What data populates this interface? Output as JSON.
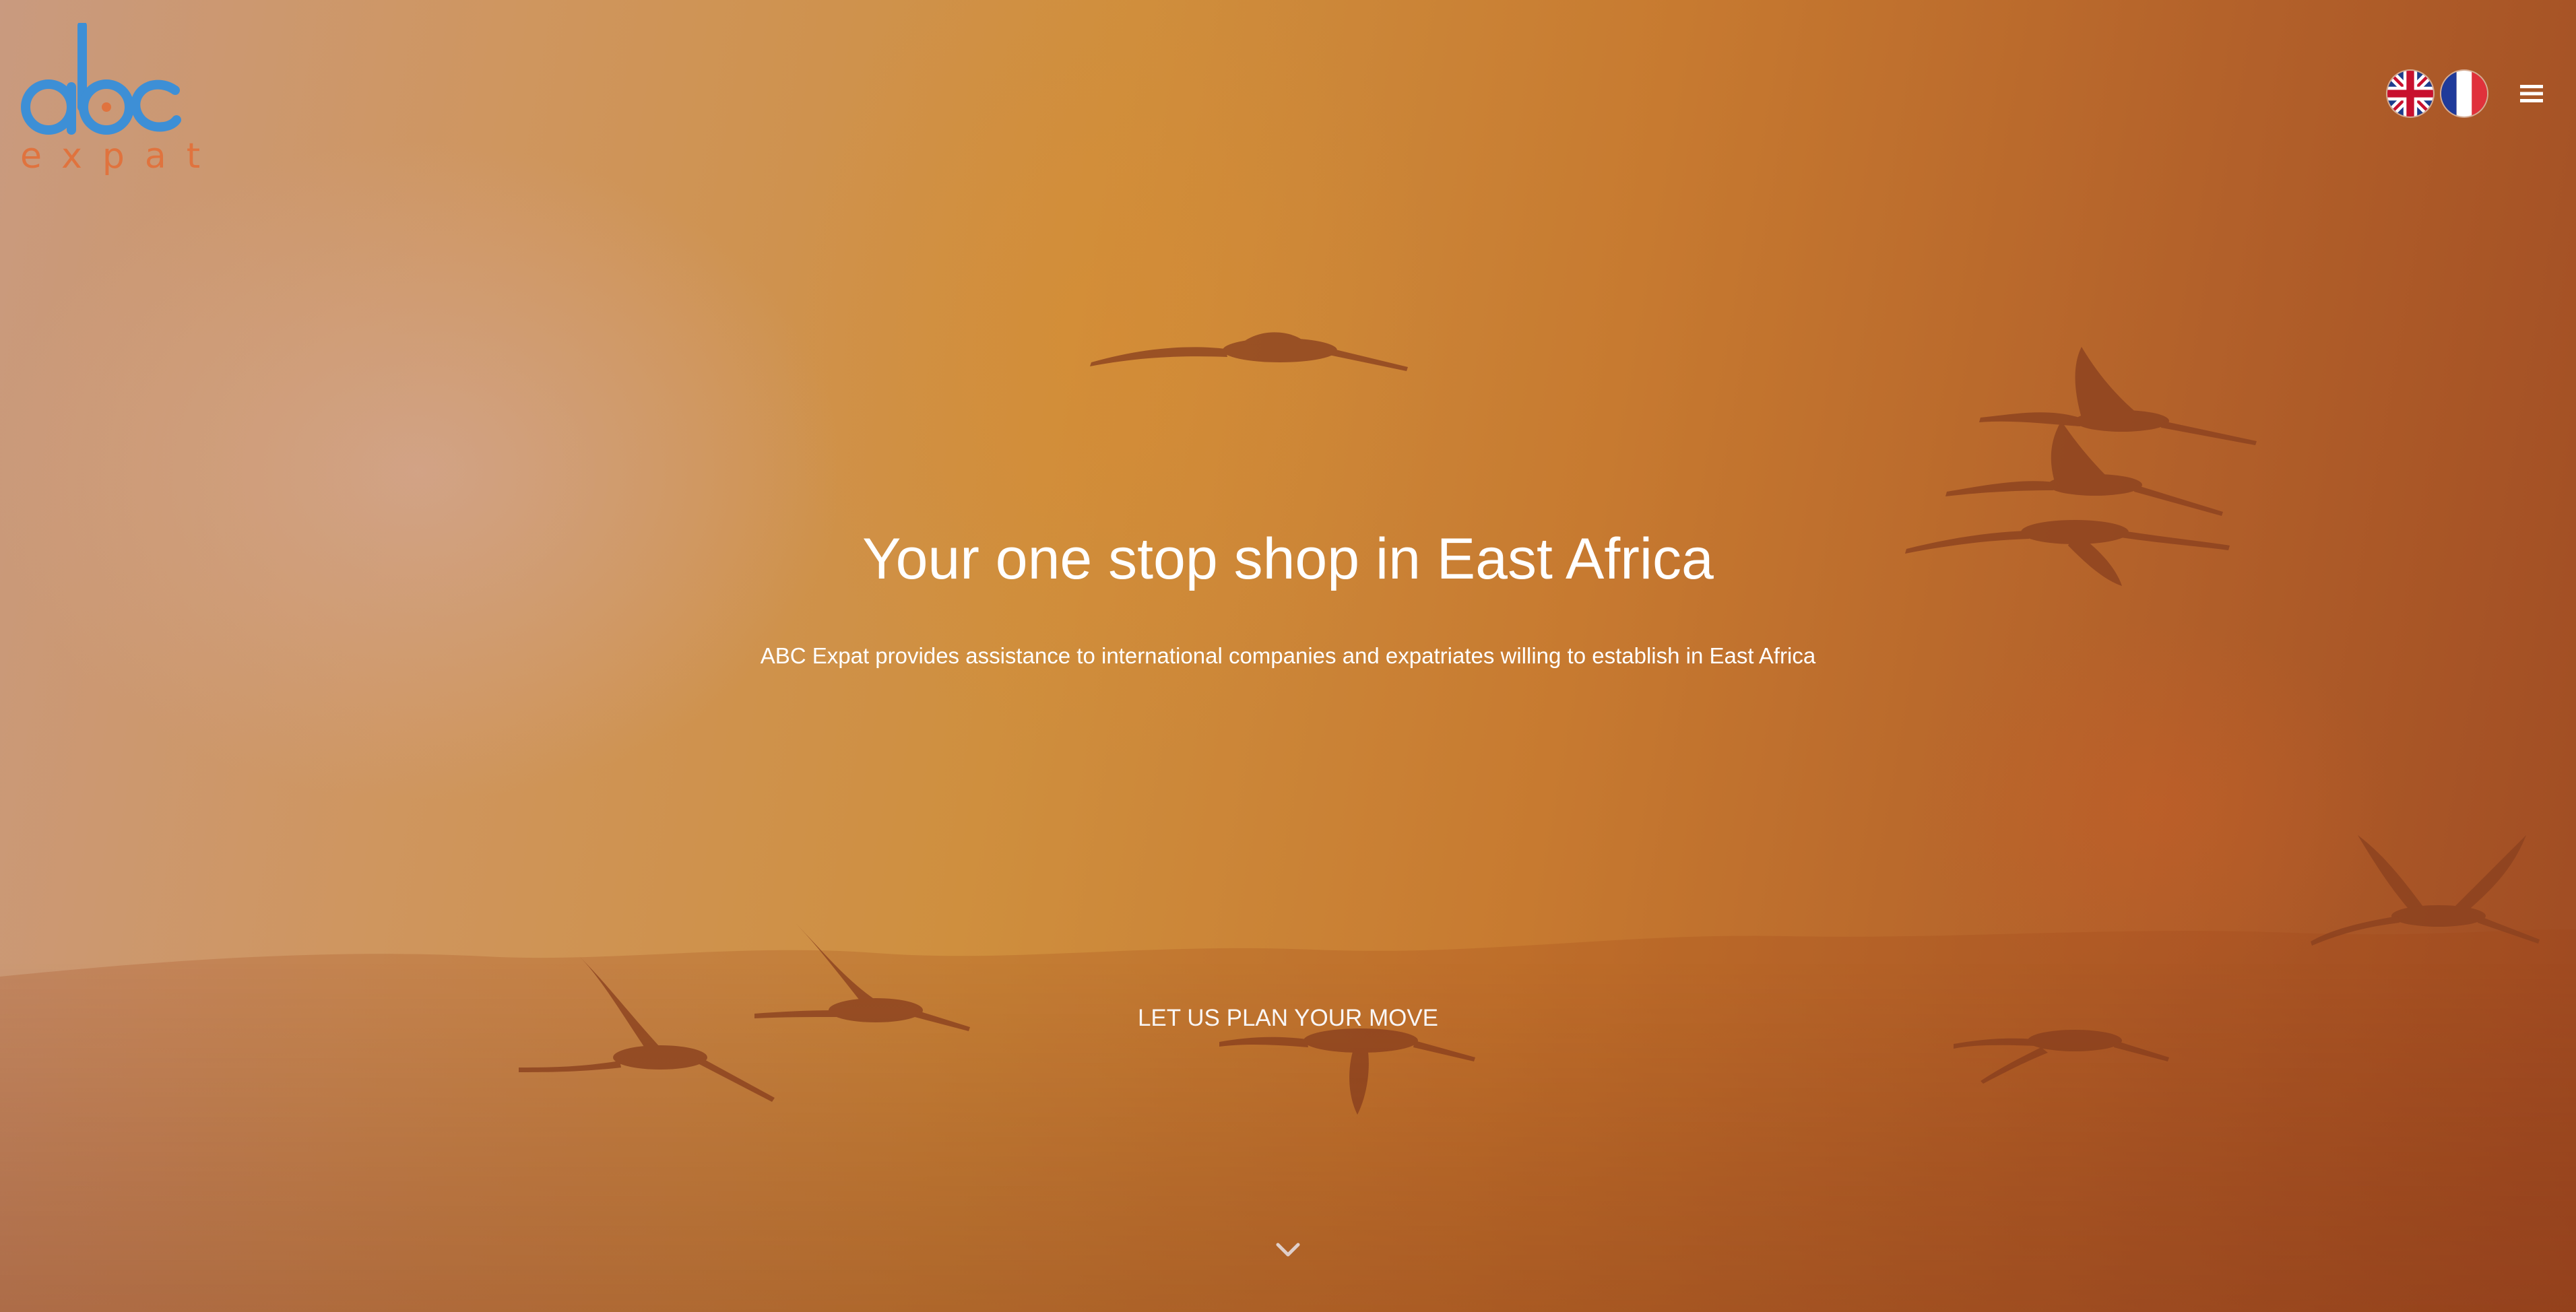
{
  "brand": {
    "logo_text": "abc",
    "logo_subtext": "expat",
    "logo_color": "#3d8fd6",
    "logo_subtext_color": "#e0733e"
  },
  "header": {
    "languages": [
      {
        "code": "en",
        "icon": "uk-flag-icon"
      },
      {
        "code": "fr",
        "icon": "france-flag-icon"
      }
    ],
    "menu_icon": "hamburger-menu-icon"
  },
  "hero": {
    "title": "Your one stop shop in East Africa",
    "subtitle": "ABC Expat provides assistance to international companies and expatriates willing to establish in East Africa",
    "cta_label": "LET US PLAN YOUR MOVE",
    "scroll_icon": "chevron-down-icon",
    "background": "sunset-flamingos-photo",
    "text_color": "#ffffff"
  }
}
